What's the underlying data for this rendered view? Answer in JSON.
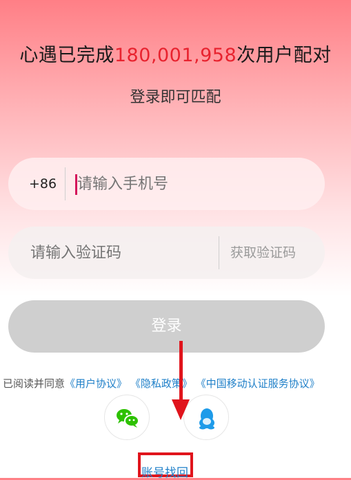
{
  "header": {
    "headline_prefix": "心遇已完成",
    "headline_count": "180,001,958",
    "headline_suffix": "次用户配对",
    "subtitle": "登录即可匹配"
  },
  "phone_field": {
    "country_code": "+86",
    "placeholder": "请输入手机号"
  },
  "code_field": {
    "placeholder": "请输入验证码",
    "get_code_label": "获取验证码"
  },
  "login_button": {
    "label": "登录"
  },
  "agreement": {
    "prefix": "已阅读并同意",
    "user_agreement": "《用户协议》",
    "privacy_policy": "《隐私政策》",
    "mobile_auth": "《中国移动认证服务协议》"
  },
  "social": {
    "wechat_icon": "wechat-icon",
    "qq_icon": "qq-icon"
  },
  "recover_link": "账号找回",
  "colors": {
    "accent_red": "#e8232f",
    "link_blue": "#1e7fc8",
    "wechat_green": "#2dc100",
    "qq_blue": "#1e9be9",
    "annotation_red": "#e0141c"
  }
}
